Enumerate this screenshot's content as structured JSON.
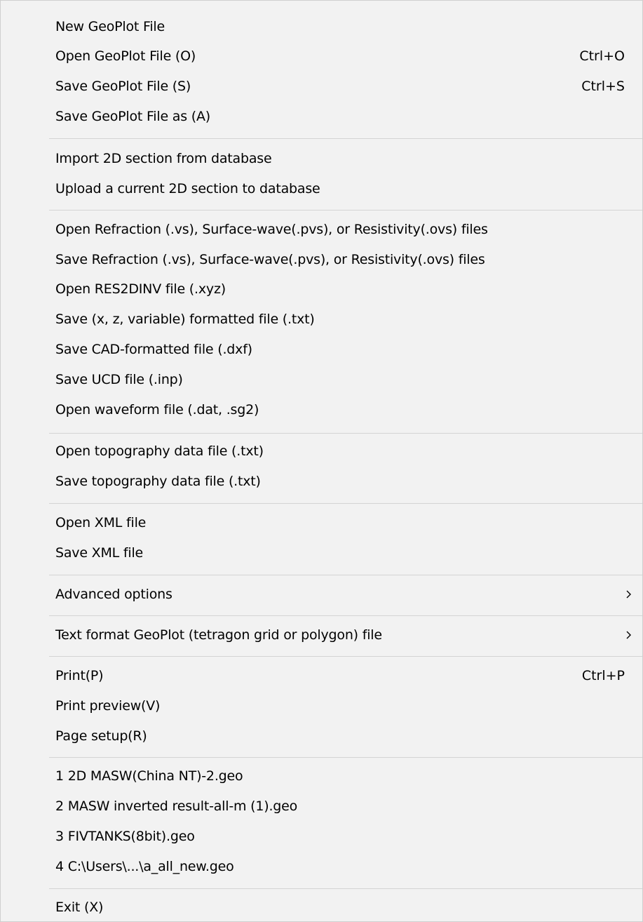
{
  "menu": {
    "items": [
      {
        "label": "New GeoPlot File",
        "shortcut": ""
      },
      {
        "label": "Open GeoPlot File (O)",
        "shortcut": "Ctrl+O"
      },
      {
        "label": "Save GeoPlot File (S)",
        "shortcut": "Ctrl+S"
      },
      {
        "label": "Save GeoPlot File as (A)",
        "shortcut": ""
      },
      {
        "label": "Import 2D section from database",
        "shortcut": ""
      },
      {
        "label": "Upload a current 2D section to database",
        "shortcut": ""
      },
      {
        "label": "Open Refraction (.vs), Surface-wave(.pvs), or Resistivity(.ovs) files",
        "shortcut": ""
      },
      {
        "label": "Save Refraction (.vs), Surface-wave(.pvs), or Resistivity(.ovs) files",
        "shortcut": ""
      },
      {
        "label": "Open RES2DINV file (.xyz)",
        "shortcut": ""
      },
      {
        "label": "Save (x, z, variable) formatted file (.txt)",
        "shortcut": ""
      },
      {
        "label": "Save CAD-formatted file (.dxf)",
        "shortcut": ""
      },
      {
        "label": "Save UCD file (.inp)",
        "shortcut": ""
      },
      {
        "label": "Open waveform file (.dat, .sg2)",
        "shortcut": ""
      },
      {
        "label": "Open topography data file (.txt)",
        "shortcut": ""
      },
      {
        "label": "Save topography data file (.txt)",
        "shortcut": ""
      },
      {
        "label": "Open XML file",
        "shortcut": ""
      },
      {
        "label": "Save XML file",
        "shortcut": ""
      },
      {
        "label": "Advanced options",
        "shortcut": "",
        "submenu_icon": "chevron-right-icon"
      },
      {
        "label": "Text format GeoPlot (tetragon grid or polygon) file",
        "shortcut": "",
        "submenu_icon": "chevron-right-icon"
      },
      {
        "label": "Print(P)",
        "shortcut": "Ctrl+P"
      },
      {
        "label": "Print preview(V)",
        "shortcut": ""
      },
      {
        "label": "Page setup(R)",
        "shortcut": ""
      },
      {
        "label": "1 2D MASW(China NT)-2.geo",
        "shortcut": ""
      },
      {
        "label": "2 MASW inverted result-all-m (1).geo",
        "shortcut": ""
      },
      {
        "label": "3 FIVTANKS(8bit).geo",
        "shortcut": ""
      },
      {
        "label": "4 C:\\Users\\...\\a_all_new.geo",
        "shortcut": ""
      },
      {
        "label": "Exit (X)",
        "shortcut": ""
      }
    ]
  },
  "colors": {
    "background": "#f2f2f2",
    "separator": "#d4d4d4",
    "text": "#000000"
  }
}
